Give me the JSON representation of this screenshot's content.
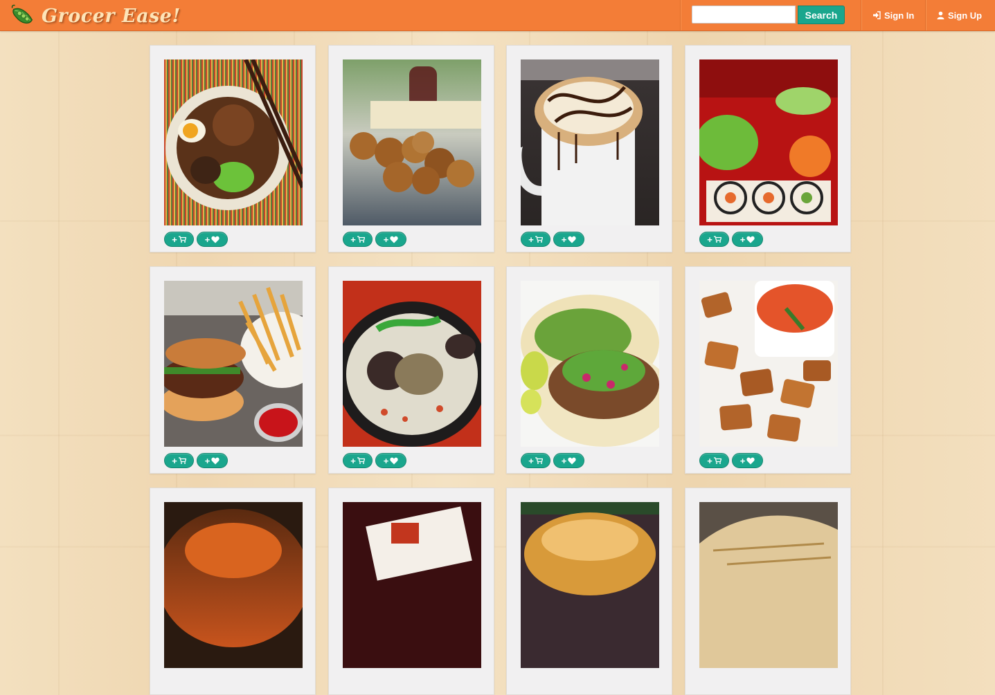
{
  "navbar": {
    "brand": "Grocer Ease!",
    "search": {
      "value": "",
      "placeholder": "",
      "button_label": "Search"
    },
    "sign_in": "Sign In",
    "sign_up": "Sign Up"
  },
  "colors": {
    "navbar": "#f37d37",
    "accent": "#1aa68d",
    "card_bg": "#f1f0f1",
    "brand_text": "#fde4b8"
  },
  "cards": [
    {
      "photo": "ramen-bowl",
      "cart_icon": "cart-icon",
      "fav_icon": "heart-icon"
    },
    {
      "photo": "arancini-balls",
      "cart_icon": "cart-icon",
      "fav_icon": "heart-icon"
    },
    {
      "photo": "marshmallow-hot-chocolate",
      "cart_icon": "cart-icon",
      "fav_icon": "heart-icon"
    },
    {
      "photo": "sushi-bento",
      "cart_icon": "cart-icon",
      "fav_icon": "heart-icon"
    },
    {
      "photo": "burger-and-fries",
      "cart_icon": "cart-icon",
      "fav_icon": "heart-icon"
    },
    {
      "photo": "korean-soup",
      "cart_icon": "cart-icon",
      "fav_icon": "heart-icon"
    },
    {
      "photo": "tacos",
      "cart_icon": "cart-icon",
      "fav_icon": "heart-icon"
    },
    {
      "photo": "toasted-ravioli",
      "cart_icon": "cart-icon",
      "fav_icon": "heart-icon"
    },
    {
      "photo": "pizza",
      "cart_icon": "cart-icon",
      "fav_icon": "heart-icon"
    },
    {
      "photo": "plated-dish",
      "cart_icon": "cart-icon",
      "fav_icon": "heart-icon"
    },
    {
      "photo": "sandwich",
      "cart_icon": "cart-icon",
      "fav_icon": "heart-icon"
    },
    {
      "photo": "flatbread",
      "cart_icon": "cart-icon",
      "fav_icon": "heart-icon"
    }
  ]
}
